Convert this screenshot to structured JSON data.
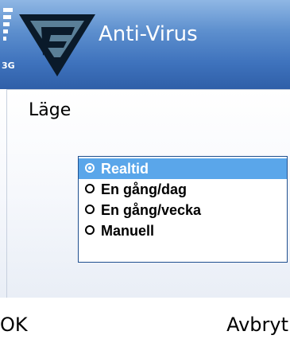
{
  "status_bar": {
    "network": "3G",
    "icons": [
      "signal-strength-icon"
    ]
  },
  "header": {
    "app_title": "Anti-Virus",
    "logo_icon": "f-secure-logo-icon"
  },
  "form": {
    "label": "Läge"
  },
  "popup": {
    "options": [
      {
        "label": "Realtid",
        "selected": true
      },
      {
        "label": "En gång/dag",
        "selected": false
      },
      {
        "label": "En gång/vecka",
        "selected": false
      },
      {
        "label": "Manuell",
        "selected": false
      }
    ]
  },
  "softkeys": {
    "left": "OK",
    "right": "Avbryt"
  },
  "colors": {
    "header": "#3f73bd",
    "selection": "#5aa6ea",
    "popup_border": "#1f4f8f"
  }
}
